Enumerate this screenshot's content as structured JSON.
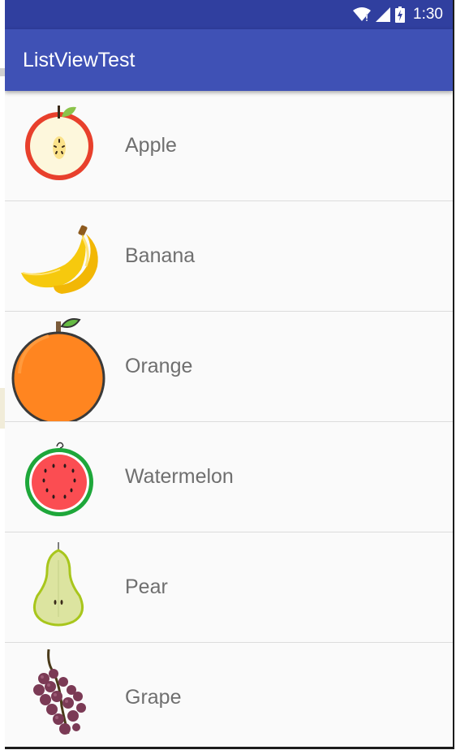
{
  "status_bar": {
    "time": "1:30",
    "icons": [
      "wifi-icon",
      "cell-signal-icon",
      "battery-icon"
    ],
    "color": "#303f9f"
  },
  "app_bar": {
    "title": "ListViewTest",
    "color": "#3f51b5"
  },
  "list": {
    "items": [
      {
        "name": "Apple",
        "icon": "apple-icon"
      },
      {
        "name": "Banana",
        "icon": "banana-icon"
      },
      {
        "name": "Orange",
        "icon": "orange-icon"
      },
      {
        "name": "Watermelon",
        "icon": "watermelon-icon"
      },
      {
        "name": "Pear",
        "icon": "pear-icon"
      },
      {
        "name": "Grape",
        "icon": "grape-icon"
      }
    ]
  }
}
